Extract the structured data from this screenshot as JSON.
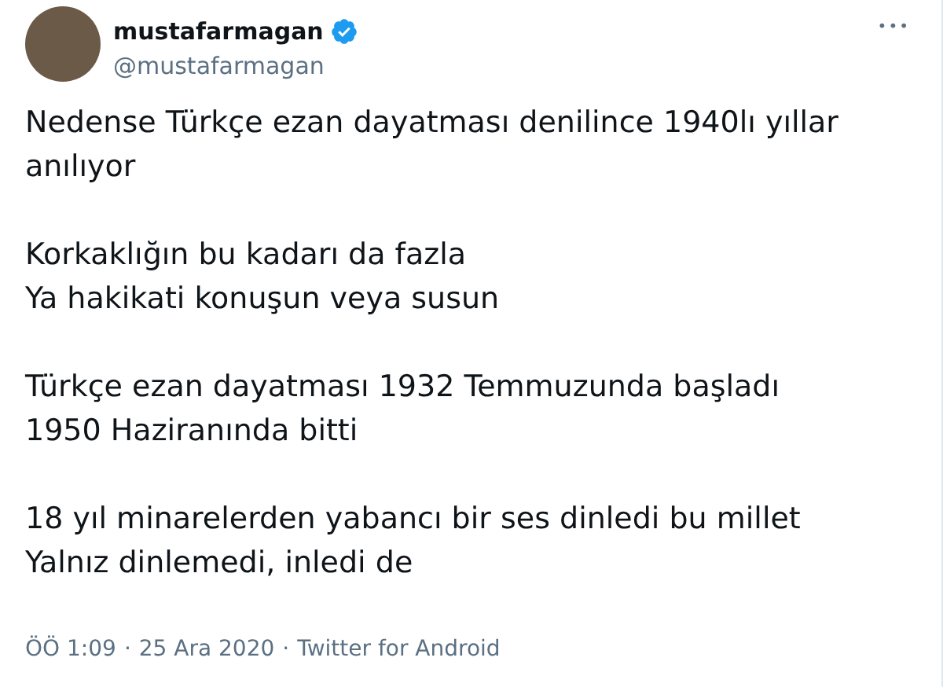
{
  "author": {
    "name": "mustafarmagan",
    "verified": true,
    "handle": "@mustafarmagan"
  },
  "menu": {
    "icon": "•••"
  },
  "paragraphs": [
    {
      "lines": [
        "Nedense Türkçe ezan dayatması denilince 1940lı yıllar",
        "anılıyor"
      ]
    },
    {
      "lines": [
        "Korkaklığın bu kadarı da fazla",
        "Ya hakikati konuşun veya susun"
      ]
    },
    {
      "lines": [
        "Türkçe ezan dayatması 1932  Temmuzunda başladı",
        "1950 Haziranında bitti"
      ]
    },
    {
      "lines": [
        "18 yıl minarelerden yabancı bir ses dinledi bu millet",
        "Yalnız dinlemedi, inledi de"
      ]
    }
  ],
  "footer": {
    "time": "ÖÖ 1:09",
    "separator": "·",
    "date": "25 Ara 2020",
    "source": "Twitter for Android"
  }
}
